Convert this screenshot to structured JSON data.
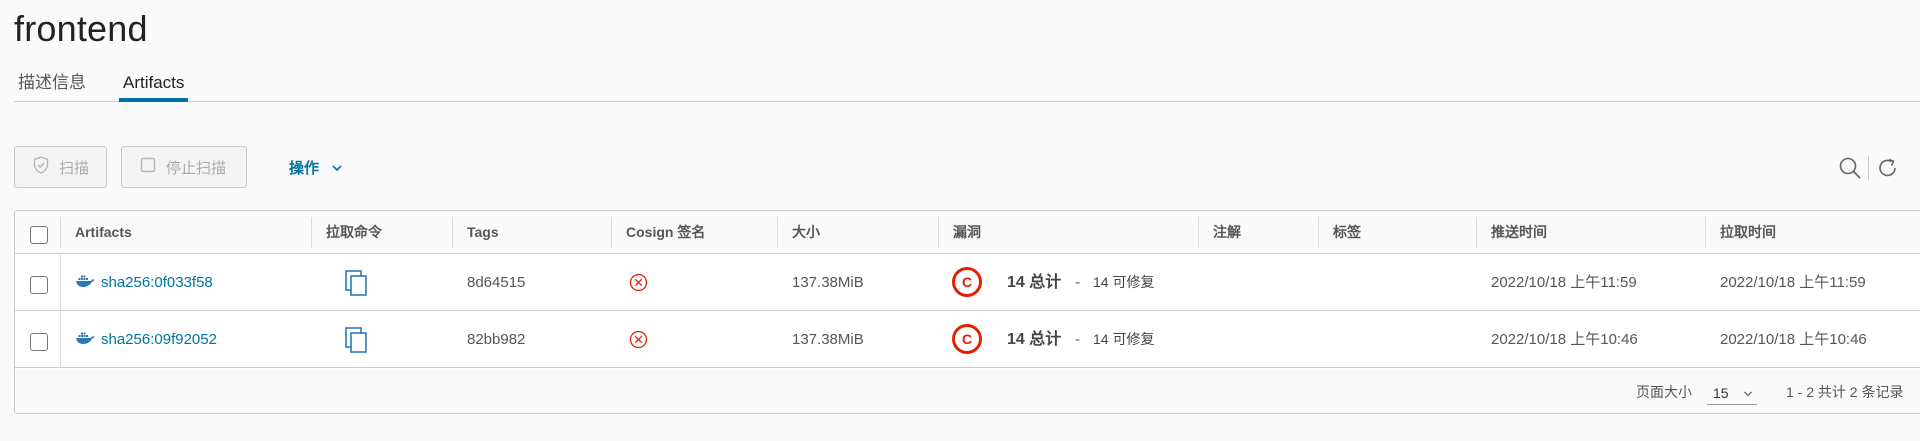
{
  "page": {
    "title": "frontend"
  },
  "tabs": [
    {
      "label": "描述信息",
      "active": false
    },
    {
      "label": "Artifacts",
      "active": true
    }
  ],
  "toolbar": {
    "scan_label": "扫描",
    "stop_scan_label": "停止扫描",
    "actions_label": "操作"
  },
  "table": {
    "columns": [
      "Artifacts",
      "拉取命令",
      "Tags",
      "Cosign 签名",
      "大小",
      "漏洞",
      "注解",
      "标签",
      "推送时间",
      "拉取时间"
    ],
    "rows": [
      {
        "artifact": "sha256:0f033f58",
        "tag": "8d64515",
        "size": "137.38MiB",
        "severity": "C",
        "total": "14 总计",
        "sep": "-",
        "fixable": "14 可修复",
        "push_time": "2022/10/18 上午11:59",
        "pull_time": "2022/10/18 上午11:59"
      },
      {
        "artifact": "sha256:09f92052",
        "tag": "82bb982",
        "size": "137.38MiB",
        "severity": "C",
        "total": "14 总计",
        "sep": "-",
        "fixable": "14 可修复",
        "push_time": "2022/10/18 上午10:46",
        "pull_time": "2022/10/18 上午10:46"
      }
    ]
  },
  "footer": {
    "page_size_label": "页面大小",
    "page_size": "15",
    "summary": "1 - 2 共计 2 条记录"
  },
  "colors": {
    "accent": "#0072a3",
    "critical": "#e12200",
    "unsigned": "#e12200"
  },
  "icons": [
    "shield-icon",
    "checkbox-icon",
    "chevron-down-icon",
    "search-icon",
    "refresh-icon",
    "docker-icon",
    "copy-icon",
    "close-circle-icon"
  ]
}
